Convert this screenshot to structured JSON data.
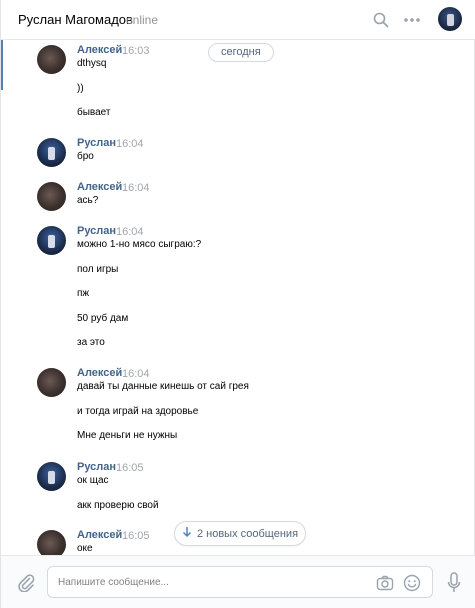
{
  "header": {
    "name": "Руслан Магомадов",
    "status": "online"
  },
  "date_divider": "сегодня",
  "messages": [
    {
      "author": "Алексей",
      "avatar": "aleksey",
      "time": "16:03",
      "lines": [
        "dthysq",
        "))",
        "бывает"
      ]
    },
    {
      "author": "Руслан",
      "avatar": "ruslan",
      "time": "16:04",
      "lines": [
        "бро"
      ]
    },
    {
      "author": "Алексей",
      "avatar": "aleksey",
      "time": "16:04",
      "lines": [
        "ась?"
      ]
    },
    {
      "author": "Руслан",
      "avatar": "ruslan",
      "time": "16:04",
      "lines": [
        "можно 1-но мясо сыграю:?",
        "пол игры",
        "пж",
        "50 руб дам",
        "за это"
      ]
    },
    {
      "author": "Алексей",
      "avatar": "aleksey",
      "time": "16:04",
      "lines": [
        "давай ты данные кинешь от сай грея",
        "и тогда играй на здоровье",
        "Мне деньги не нужны"
      ]
    },
    {
      "author": "Руслан",
      "avatar": "ruslan",
      "time": "16:05",
      "lines": [
        "ок щас",
        "акк проверю свой"
      ]
    },
    {
      "author": "Алексей",
      "avatar": "aleksey",
      "time": "16:05",
      "lines": [
        "оке"
      ]
    }
  ],
  "new_messages": "2 новых сообщения",
  "composer": {
    "placeholder": "Напишите сообщение..."
  },
  "colors": {
    "accent": "#5181b8",
    "author": "#42648b",
    "muted": "#939393"
  },
  "icons": [
    "search-icon",
    "more-icon",
    "attach-icon",
    "camera-icon",
    "smile-icon",
    "mic-icon",
    "arrow-down-icon"
  ]
}
